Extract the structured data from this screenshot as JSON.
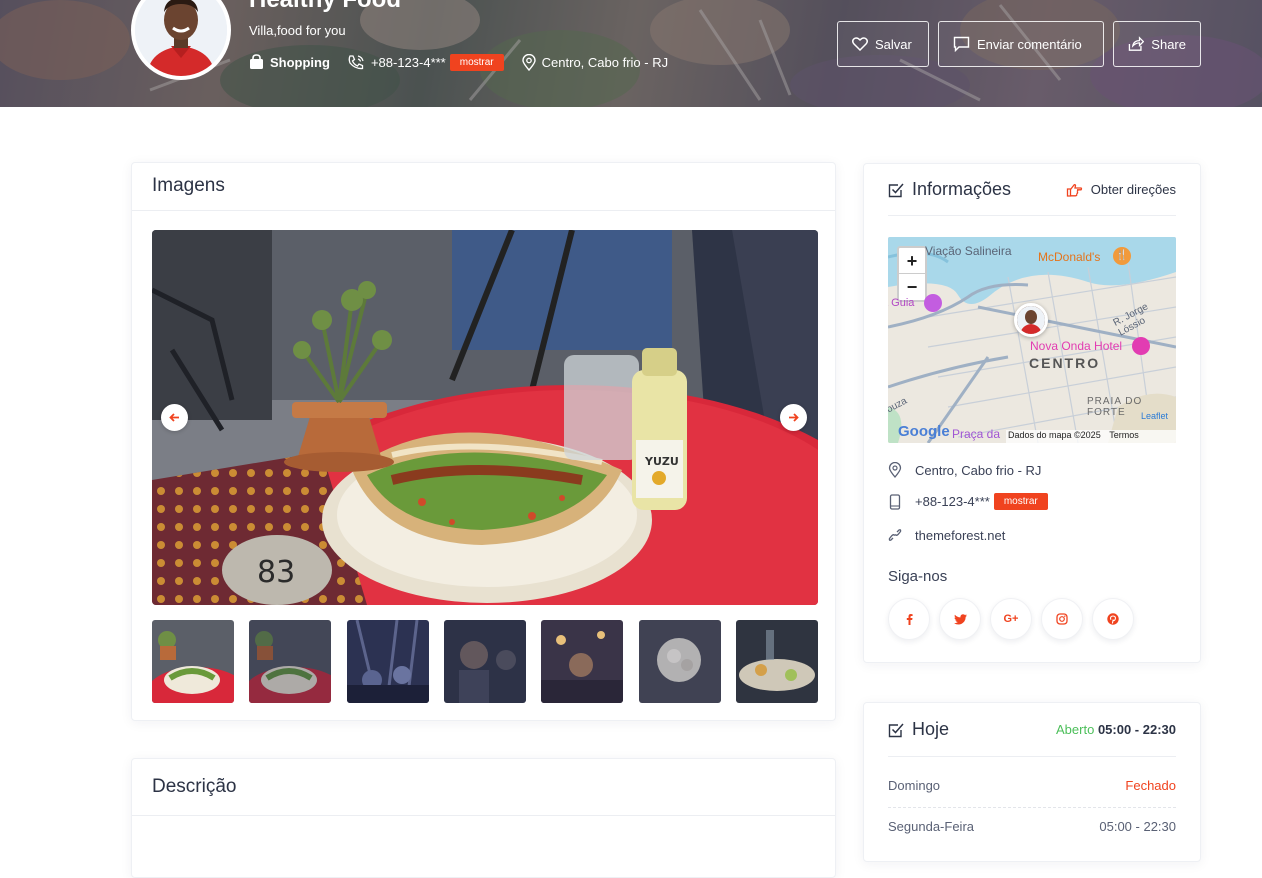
{
  "hero": {
    "title": "Healthy Food",
    "tagline": "Villa,food for you",
    "category": "Shopping",
    "phone": "+88-123-4***",
    "show_label": "mostrar",
    "address": "Centro, Cabo frio - RJ",
    "actions": {
      "save": "Salvar",
      "comment": "Enviar comentário",
      "share": "Share"
    }
  },
  "images_card": {
    "title": "Imagens",
    "thumbnail_count": 7
  },
  "description_card": {
    "title": "Descrição"
  },
  "info_card": {
    "title": "Informações",
    "directions": "Obter direções",
    "map": {
      "labels": {
        "viacao": "Viação Salineira",
        "mcdonalds": "McDonald's",
        "guia": "a Guia",
        "street": "R. Jorge Lóssio",
        "hotel": "Nova Onda Hotel",
        "centro": "CENTRO",
        "praia": "PRAIA DO FORTE",
        "souza": "ouza",
        "praca": "Praça da",
        "leaflet": "Leaflet",
        "google": "Google",
        "map_data": "Dados do mapa ©2025",
        "terms": "Termos"
      },
      "zoom_in": "+",
      "zoom_out": "−"
    },
    "address": "Centro, Cabo frio - RJ",
    "phone": "+88-123-4***",
    "show_label": "mostrar",
    "website": "themeforest.net",
    "follow": "Siga-nos",
    "socials": [
      "facebook-icon",
      "twitter-icon",
      "google-plus-icon",
      "instagram-icon",
      "pinterest-icon"
    ],
    "social_glyphs": {
      "google_plus": "G+"
    }
  },
  "hours_card": {
    "title": "Hoje",
    "status": "Aberto",
    "today_hours": "05:00 - 22:30",
    "rows": [
      {
        "day": "Domingo",
        "value": "Fechado"
      },
      {
        "day": "Segunda-Feira",
        "value": "05:00 - 22:30"
      }
    ]
  },
  "colors": {
    "accent": "#f0431f",
    "open": "#4cbf5a",
    "text": "#2c3345"
  }
}
